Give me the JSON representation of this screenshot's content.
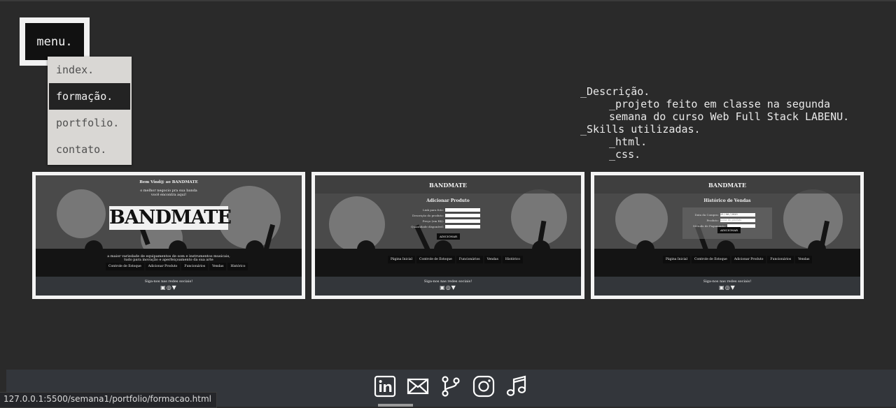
{
  "menu": {
    "label": "menu.",
    "items": [
      {
        "label": "index."
      },
      {
        "label": "formação."
      },
      {
        "label": "portfolio."
      },
      {
        "label": "contato."
      }
    ],
    "active_index": 1
  },
  "description": {
    "heading": "_Descrição.",
    "line1": "_projeto feito em classe na segunda",
    "line2": "semana do curso Web Full Stack LABENU.",
    "skills_heading": "_Skills utilizadas.",
    "skill1": "_html.",
    "skill2": "_css."
  },
  "cards": [
    {
      "welcome": "Bem Vind@ ao BANDMATE",
      "tag1": "o melhor negocio pra sua banda",
      "tag2": "você encontra aqui!",
      "logo": "BANDMATE",
      "blurb1": "a maior variedade de equipamentos de som e instrumentos musicais,",
      "blurb2": "tudo para inovação e aperfeiçoamento da sua arte",
      "nav": [
        "Controle de Estoque",
        "Adicionar Produto",
        "Funcionários",
        "Vendas",
        "Histórico"
      ],
      "social": "Siga-nos nas redes sociais!"
    },
    {
      "logo": "BANDMATE",
      "title": "Adicionar Produto",
      "fields": [
        "Link para foto:",
        "Descrição do produto:",
        "Preço (em R$):",
        "Quantidade disponível:"
      ],
      "button": "ADICIONAR",
      "nav": [
        "Página Inicial",
        "Controle de Estoque",
        "Funcionários",
        "Vendas",
        "Histórico"
      ],
      "social": "Siga-nos nas redes sociais!"
    },
    {
      "logo": "BANDMATE",
      "title": "Histórico de Vendas",
      "fields": [
        "Data da Compra:",
        "Produto:",
        "Método de Pagamento:"
      ],
      "date_value": "25 / 06 / 2020",
      "product_placeholder": "nome do produto",
      "button": "ADICIONAR",
      "nav": [
        "Página Inicial",
        "Controle de Estoque",
        "Adicionar Produto",
        "Funcionários",
        "Vendas"
      ],
      "social": "Siga-nos nas redes sociais!"
    }
  ],
  "footer": {
    "icons": [
      "linkedin-icon",
      "email-icon",
      "git-branch-icon",
      "instagram-icon",
      "music-icon"
    ]
  },
  "status_url": "127.0.0.1:5500/semana1/portfolio/formacao.html"
}
